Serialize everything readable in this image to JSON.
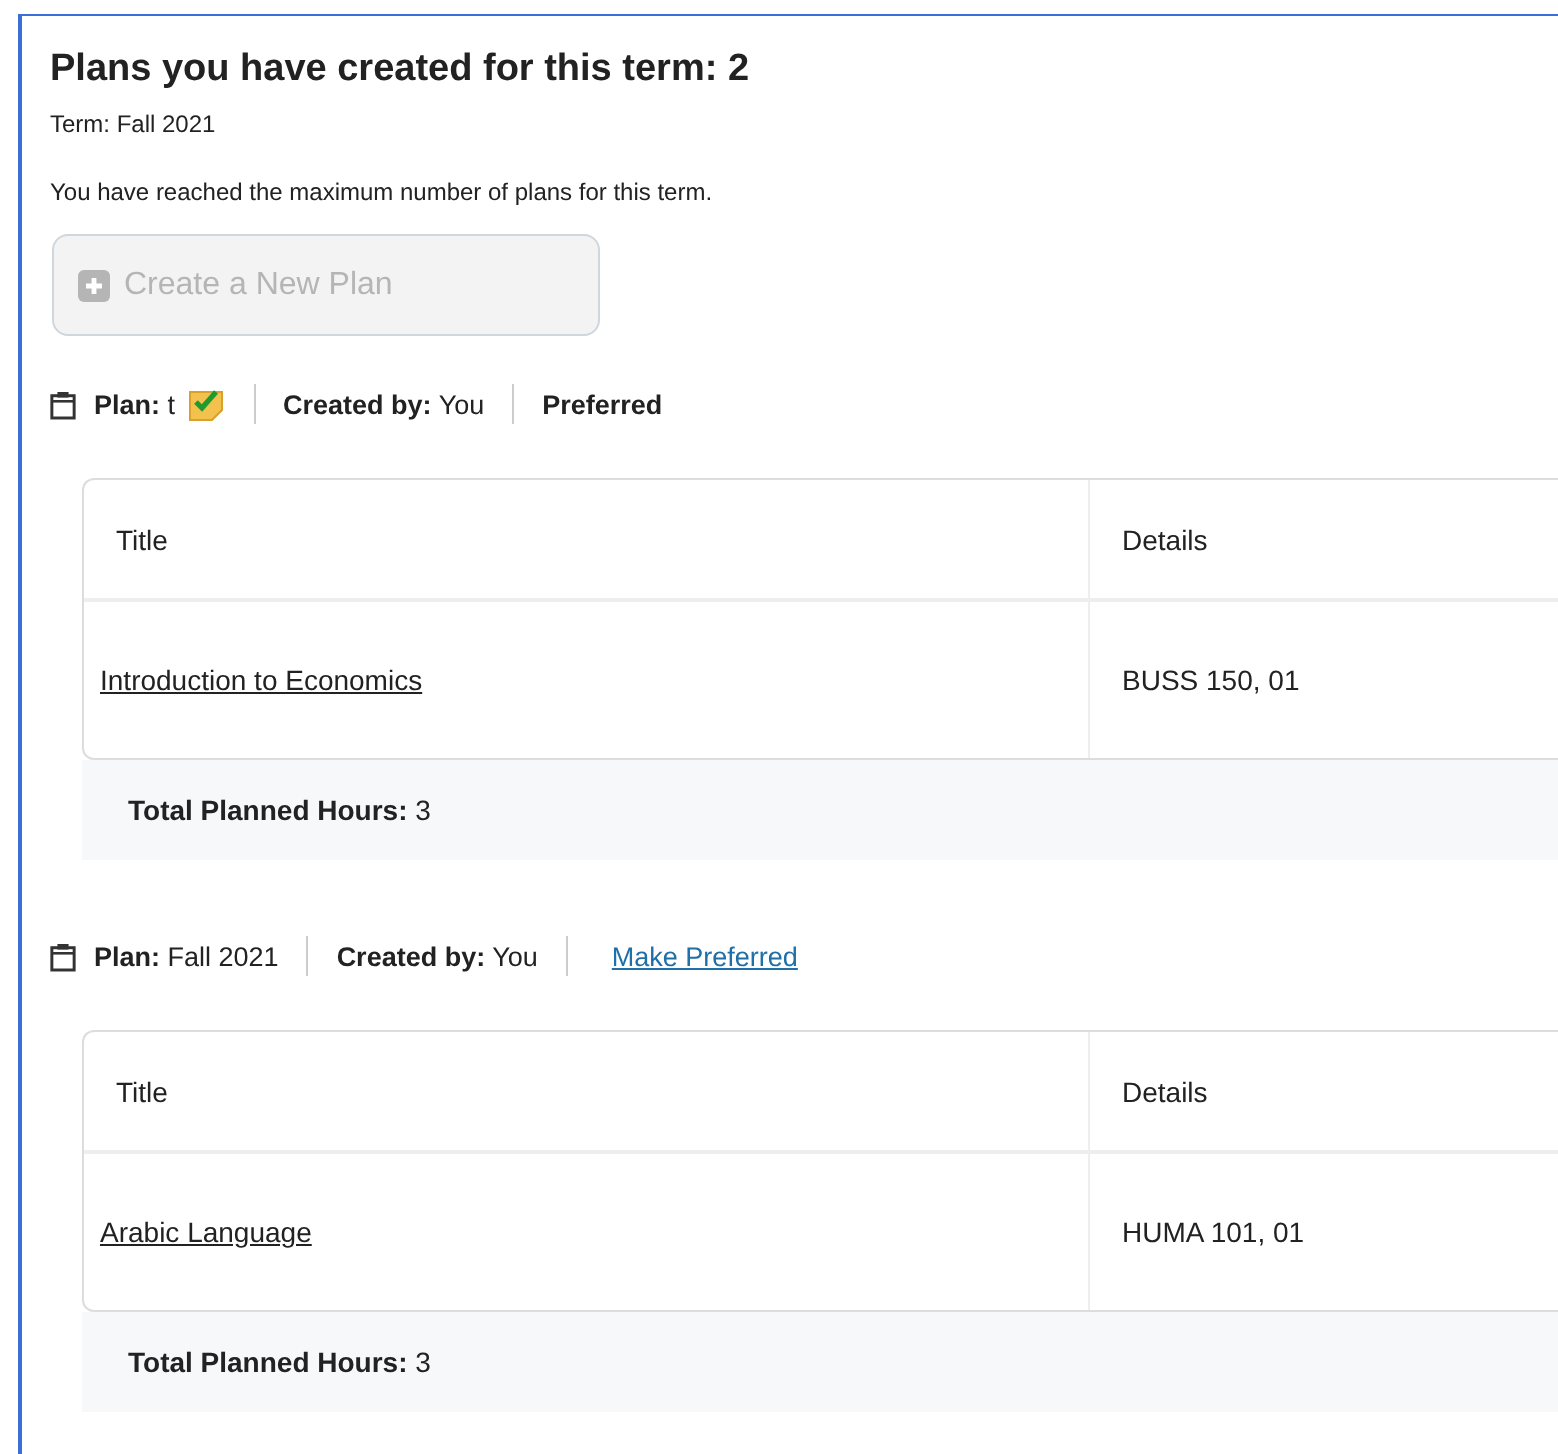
{
  "heading": "Plans you have created for this term: 2",
  "term": "Term: Fall 2021",
  "notice": "You have reached the maximum number of plans for this term.",
  "create_button": {
    "label": "Create a New Plan",
    "disabled": true
  },
  "plans": [
    {
      "plan_label": "Plan:",
      "name": "t",
      "preferred": true,
      "created_label": "Created by:",
      "created_by": "You",
      "preferred_text": "Preferred",
      "columns": [
        "Title",
        "Details"
      ],
      "rows": [
        {
          "title": "Introduction to Economics",
          "details": "BUSS 150, 01"
        }
      ],
      "total_label": "Total Planned Hours:",
      "total": "3"
    },
    {
      "plan_label": "Plan:",
      "name": "Fall 2021",
      "preferred": false,
      "created_label": "Created by:",
      "created_by": "You",
      "preferred_text": "Make Preferred",
      "columns": [
        "Title",
        "Details"
      ],
      "rows": [
        {
          "title": "Arabic Language",
          "details": "HUMA 101, 01"
        }
      ],
      "total_label": "Total Planned Hours:",
      "total": "3"
    }
  ]
}
